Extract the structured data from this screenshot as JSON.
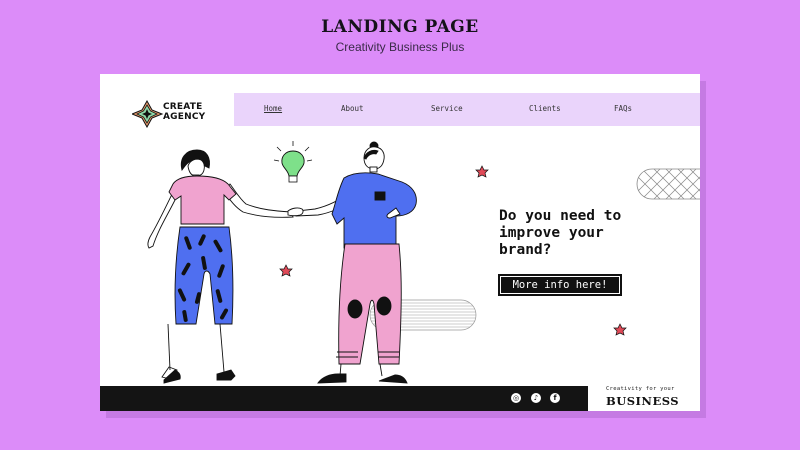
{
  "page": {
    "title": "LANDING PAGE",
    "subtitle": "Creativity Business Plus"
  },
  "brand": {
    "line1": "CREATE",
    "line2": "AGENCY",
    "logo_icon": "sparkle-star-icon"
  },
  "nav": {
    "items": [
      {
        "label": "Home",
        "active": true
      },
      {
        "label": "About",
        "active": false
      },
      {
        "label": "Service",
        "active": false
      },
      {
        "label": "Clients",
        "active": false
      },
      {
        "label": "FAQs",
        "active": false
      }
    ]
  },
  "hero": {
    "headline_line1": "Do you need to",
    "headline_line2": "improve your",
    "headline_line3": "brand?",
    "cta_label": "More info here!"
  },
  "footer": {
    "social": [
      {
        "icon": "instagram-icon",
        "glyph": "◎"
      },
      {
        "icon": "tiktok-icon",
        "glyph": "♪"
      },
      {
        "icon": "facebook-icon",
        "glyph": "f"
      }
    ],
    "tagline_small": "Creativity for your",
    "tagline_big": "BUSINESS"
  },
  "colors": {
    "background": "#dc8cf9",
    "nav_bg": "#ead4fb",
    "shirt_pink": "#f0a3cf",
    "pants_blue": "#4f6ff0",
    "shirt_blue": "#4f6ff0",
    "bulb_green": "#7ee08a",
    "star_red": "#e04a58"
  }
}
